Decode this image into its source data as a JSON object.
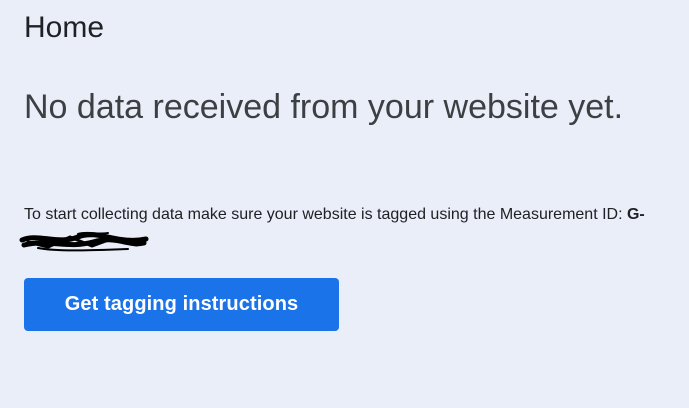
{
  "header": {
    "title": "Home"
  },
  "empty_state": {
    "title": "No data received from your website yet.",
    "description_prefix": "To start collecting data make sure your website is tagged using the Measurement ID: ",
    "measurement_id_visible": "G-",
    "cta_label": "Get tagging instructions"
  },
  "colors": {
    "background": "#e9eef9",
    "button": "#1a73e8",
    "button_text": "#ffffff"
  }
}
